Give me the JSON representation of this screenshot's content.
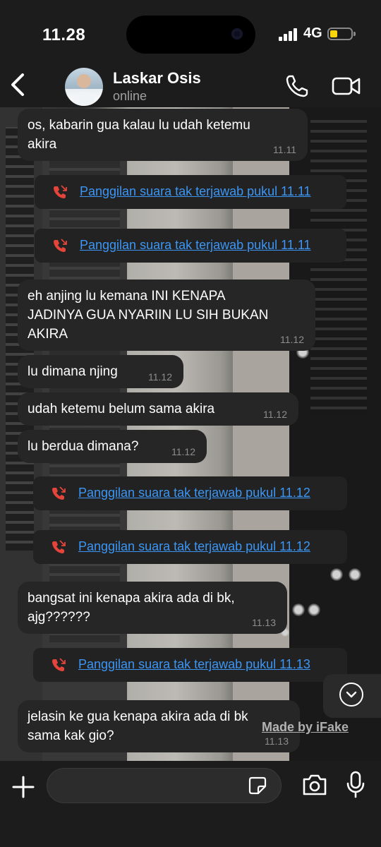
{
  "status_bar": {
    "time": "11.28",
    "network": "4G"
  },
  "header": {
    "contact_name": "Laskar Osis",
    "contact_status": "online"
  },
  "messages": [
    {
      "text": "os, kabarin gua kalau lu udah ketemu\nakira",
      "time": "11.11"
    },
    {
      "missed_call": "Panggilan suara tak terjawab pukul 11.11"
    },
    {
      "missed_call": "Panggilan suara tak terjawab pukul 11.11"
    },
    {
      "text": "eh anjing lu kemana INI KENAPA\nJADINYA GUA NYARIIN LU SIH BUKAN\nAKIRA",
      "time": "11.12"
    },
    {
      "text": "lu dimana njing",
      "time": "11.12"
    },
    {
      "text": "udah ketemu belum sama akira",
      "time": "11.12"
    },
    {
      "text": "lu berdua dimana?",
      "time": "11.12"
    },
    {
      "missed_call": "Panggilan suara tak terjawab pukul 11.12"
    },
    {
      "missed_call": "Panggilan suara tak terjawab pukul 11.12"
    },
    {
      "text": "bangsat ini kenapa akira ada di bk,\najg??????",
      "time": "11.13"
    },
    {
      "missed_call": "Panggilan suara tak terjawab pukul 11.13"
    },
    {
      "text": "jelasin ke gua kenapa akira ada di bk\nsama kak gio?",
      "time": "11.13"
    }
  ],
  "watermark": "Made by iFake",
  "icons": {
    "back": "chevron-left-icon",
    "call": "phone-icon",
    "video": "video-camera-icon",
    "missed_call": "missed-call-icon",
    "scroll_down": "chevron-down-icon",
    "plus": "plus-icon",
    "sticker": "sticker-icon",
    "camera": "camera-icon",
    "mic": "microphone-icon"
  },
  "colors": {
    "link": "#3b96f5",
    "missed_call": "#e5443a",
    "bubble": "#262626",
    "bar": "#1c1c1c",
    "battery": "#ffd60a"
  }
}
